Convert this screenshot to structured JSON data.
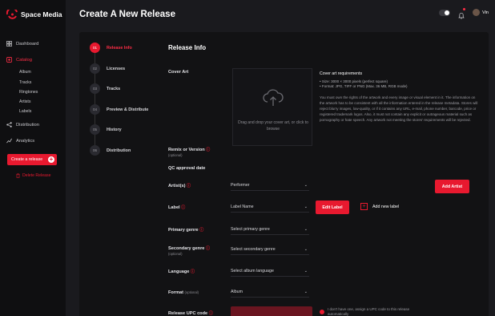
{
  "app": {
    "name": "Space Media"
  },
  "colors": {
    "accent": "#e8192f",
    "background": "#1a1a1e",
    "panel": "#121214",
    "sidebar": "#0f0f11"
  },
  "sidebar": {
    "items": [
      {
        "label": "Dashboard",
        "icon": "dashboard-icon"
      },
      {
        "label": "Catalog",
        "icon": "catalog-icon",
        "active": true
      },
      {
        "label": "Distribution",
        "icon": "distribution-icon"
      },
      {
        "label": "Analytics",
        "icon": "analytics-icon"
      }
    ],
    "catalog_sub": [
      "Album",
      "Tracks",
      "Ringtones",
      "Artists",
      "Labels"
    ],
    "create_label": "Create a release",
    "delete_label": "Delete Release"
  },
  "header": {
    "title": "Create A New Release",
    "user_name": "Vin"
  },
  "steps": [
    {
      "num": "01",
      "label": "Release Info",
      "active": true
    },
    {
      "num": "02",
      "label": "Licenses"
    },
    {
      "num": "03",
      "label": "Tracks"
    },
    {
      "num": "04",
      "label": "Preview & Distribute"
    },
    {
      "num": "05",
      "label": "History"
    },
    {
      "num": "06",
      "label": "Distribution"
    }
  ],
  "form": {
    "section_title": "Release Info",
    "cover_art_label": "Cover Art",
    "dropzone_text": "Drag and drop your cover art, or click to browse",
    "requirements": {
      "title": "Cover art requirements",
      "items": [
        "Size: 3000 × 3000 pixels (perfect square)",
        "Format: JPG, TIFF or PNG (Max. 36 MB, RGB mode)"
      ],
      "paragraph": "You must own the rights of the artwork and every image or visual element in it. The information on the artwork has to be consistent with all the information entered in the release metadata. Stores will reject blurry images, low-quality, or if it contains any URL, e-mail, phone number, barcode, price or registered trademark logos. Also, it must not contain any explicit or outrageous material such as pornography or hate speech. Any artwork not meeting the stores' requirements will be rejected."
    },
    "remix_label": "Remix or Version",
    "optional": "(optional)",
    "qc_label": "QC approval date",
    "artists_label": "Artist(s)",
    "artists_value": "Performer",
    "add_artist": "Add Artist",
    "label_label": "Label",
    "label_value": "Label Name",
    "edit_label": "Edit Label",
    "add_new_label": "Add new label",
    "primary_genre_label": "Primary genre",
    "primary_genre_placeholder": "Select primary genre",
    "secondary_genre_label": "Secondary genre",
    "secondary_genre_placeholder": "Select secondary genre",
    "language_label": "Language",
    "language_placeholder": "Select album language",
    "format_label": "Format",
    "format_optional": "(optional)",
    "format_value": "Album",
    "upc_label": "Release UPC code",
    "upc_note": "I don't have one, assign a UPC code to this release automatically"
  }
}
